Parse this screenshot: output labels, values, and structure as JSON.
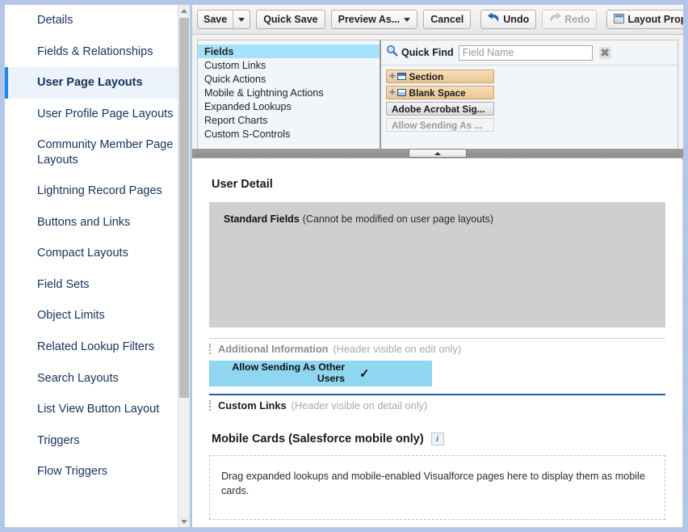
{
  "sidebar": {
    "items": [
      {
        "label": "Details",
        "active": false
      },
      {
        "label": "Fields & Relationships",
        "active": false
      },
      {
        "label": "User Page Layouts",
        "active": true
      },
      {
        "label": "User Profile Page Layouts",
        "active": false
      },
      {
        "label": "Community Member Page Layouts",
        "active": false
      },
      {
        "label": "Lightning Record Pages",
        "active": false
      },
      {
        "label": "Buttons and Links",
        "active": false
      },
      {
        "label": "Compact Layouts",
        "active": false
      },
      {
        "label": "Field Sets",
        "active": false
      },
      {
        "label": "Object Limits",
        "active": false
      },
      {
        "label": "Related Lookup Filters",
        "active": false
      },
      {
        "label": "Search Layouts",
        "active": false
      },
      {
        "label": "List View Button Layout",
        "active": false
      },
      {
        "label": "Triggers",
        "active": false
      },
      {
        "label": "Flow Triggers",
        "active": false
      }
    ],
    "scroll_up_icon": "triangle-up-icon",
    "scroll_down_icon": "triangle-down-icon"
  },
  "toolbar": {
    "save_label": "Save",
    "save_caret_icon": "caret-down-icon",
    "quick_save_label": "Quick Save",
    "preview_as_label": "Preview As...",
    "preview_caret_icon": "caret-down-icon",
    "cancel_label": "Cancel",
    "undo_label": "Undo",
    "undo_icon": "undo-arrow-icon",
    "redo_label": "Redo",
    "redo_icon": "redo-arrow-icon",
    "redo_disabled": true,
    "layout_properties_label": "Layout Properties",
    "layout_properties_icon": "layout-properties-icon"
  },
  "palette": {
    "categories": [
      {
        "label": "Fields",
        "selected": true
      },
      {
        "label": "Custom Links",
        "selected": false
      },
      {
        "label": "Quick Actions",
        "selected": false
      },
      {
        "label": "Mobile & Lightning Actions",
        "selected": false
      },
      {
        "label": "Expanded Lookups",
        "selected": false
      },
      {
        "label": "Report Charts",
        "selected": false
      },
      {
        "label": "Custom S-Controls",
        "selected": false
      }
    ],
    "quick_find": {
      "label": "Quick Find",
      "search_icon": "search-icon",
      "placeholder": "Field Name",
      "value": "",
      "clear_icon": "clear-x-icon",
      "clear_glyph": "✖"
    },
    "items": [
      {
        "label": "Section",
        "style": "tan",
        "icon": "section-icon",
        "draggable": true
      },
      {
        "label": "Blank Space",
        "style": "tan",
        "icon": "blank-space-icon",
        "draggable": true
      },
      {
        "label": "Adobe Acrobat Sig...",
        "style": "plain",
        "icon": "",
        "draggable": true
      },
      {
        "label": "Allow Sending As ...",
        "style": "dim",
        "icon": "",
        "draggable": false
      }
    ]
  },
  "splitter": {
    "collapse_icon": "triangle-up-icon"
  },
  "canvas": {
    "user_detail_title": "User Detail",
    "standard_fields": {
      "name": "Standard Fields",
      "note": "(Cannot be modified on user page layouts)"
    },
    "additional_information": {
      "name": "Additional Information",
      "note": "(Header visible on edit only)"
    },
    "allow_sending_field": {
      "label": "Allow Sending As Other Users",
      "check_glyph": "✓"
    },
    "custom_links": {
      "name": "Custom Links",
      "note": "(Header visible on detail only)"
    },
    "mobile_cards": {
      "title": "Mobile Cards (Salesforce mobile only)",
      "info_icon": "info-icon",
      "info_glyph": "i",
      "drop_text": "Drag expanded lookups and mobile-enabled Visualforce pages here to display them as mobile cards."
    }
  },
  "colors": {
    "page_background": "#b3c6e7",
    "accent_blue": "#1589ee",
    "selected_sidebar": "#ecf3fb",
    "palette_selected": "#a5e2fb",
    "field_highlight": "#8fd6f1",
    "palette_item_tan": "#ebc697",
    "standard_fields_gray": "#cfcfcf",
    "section_divider_blue": "#2a5d9e"
  }
}
